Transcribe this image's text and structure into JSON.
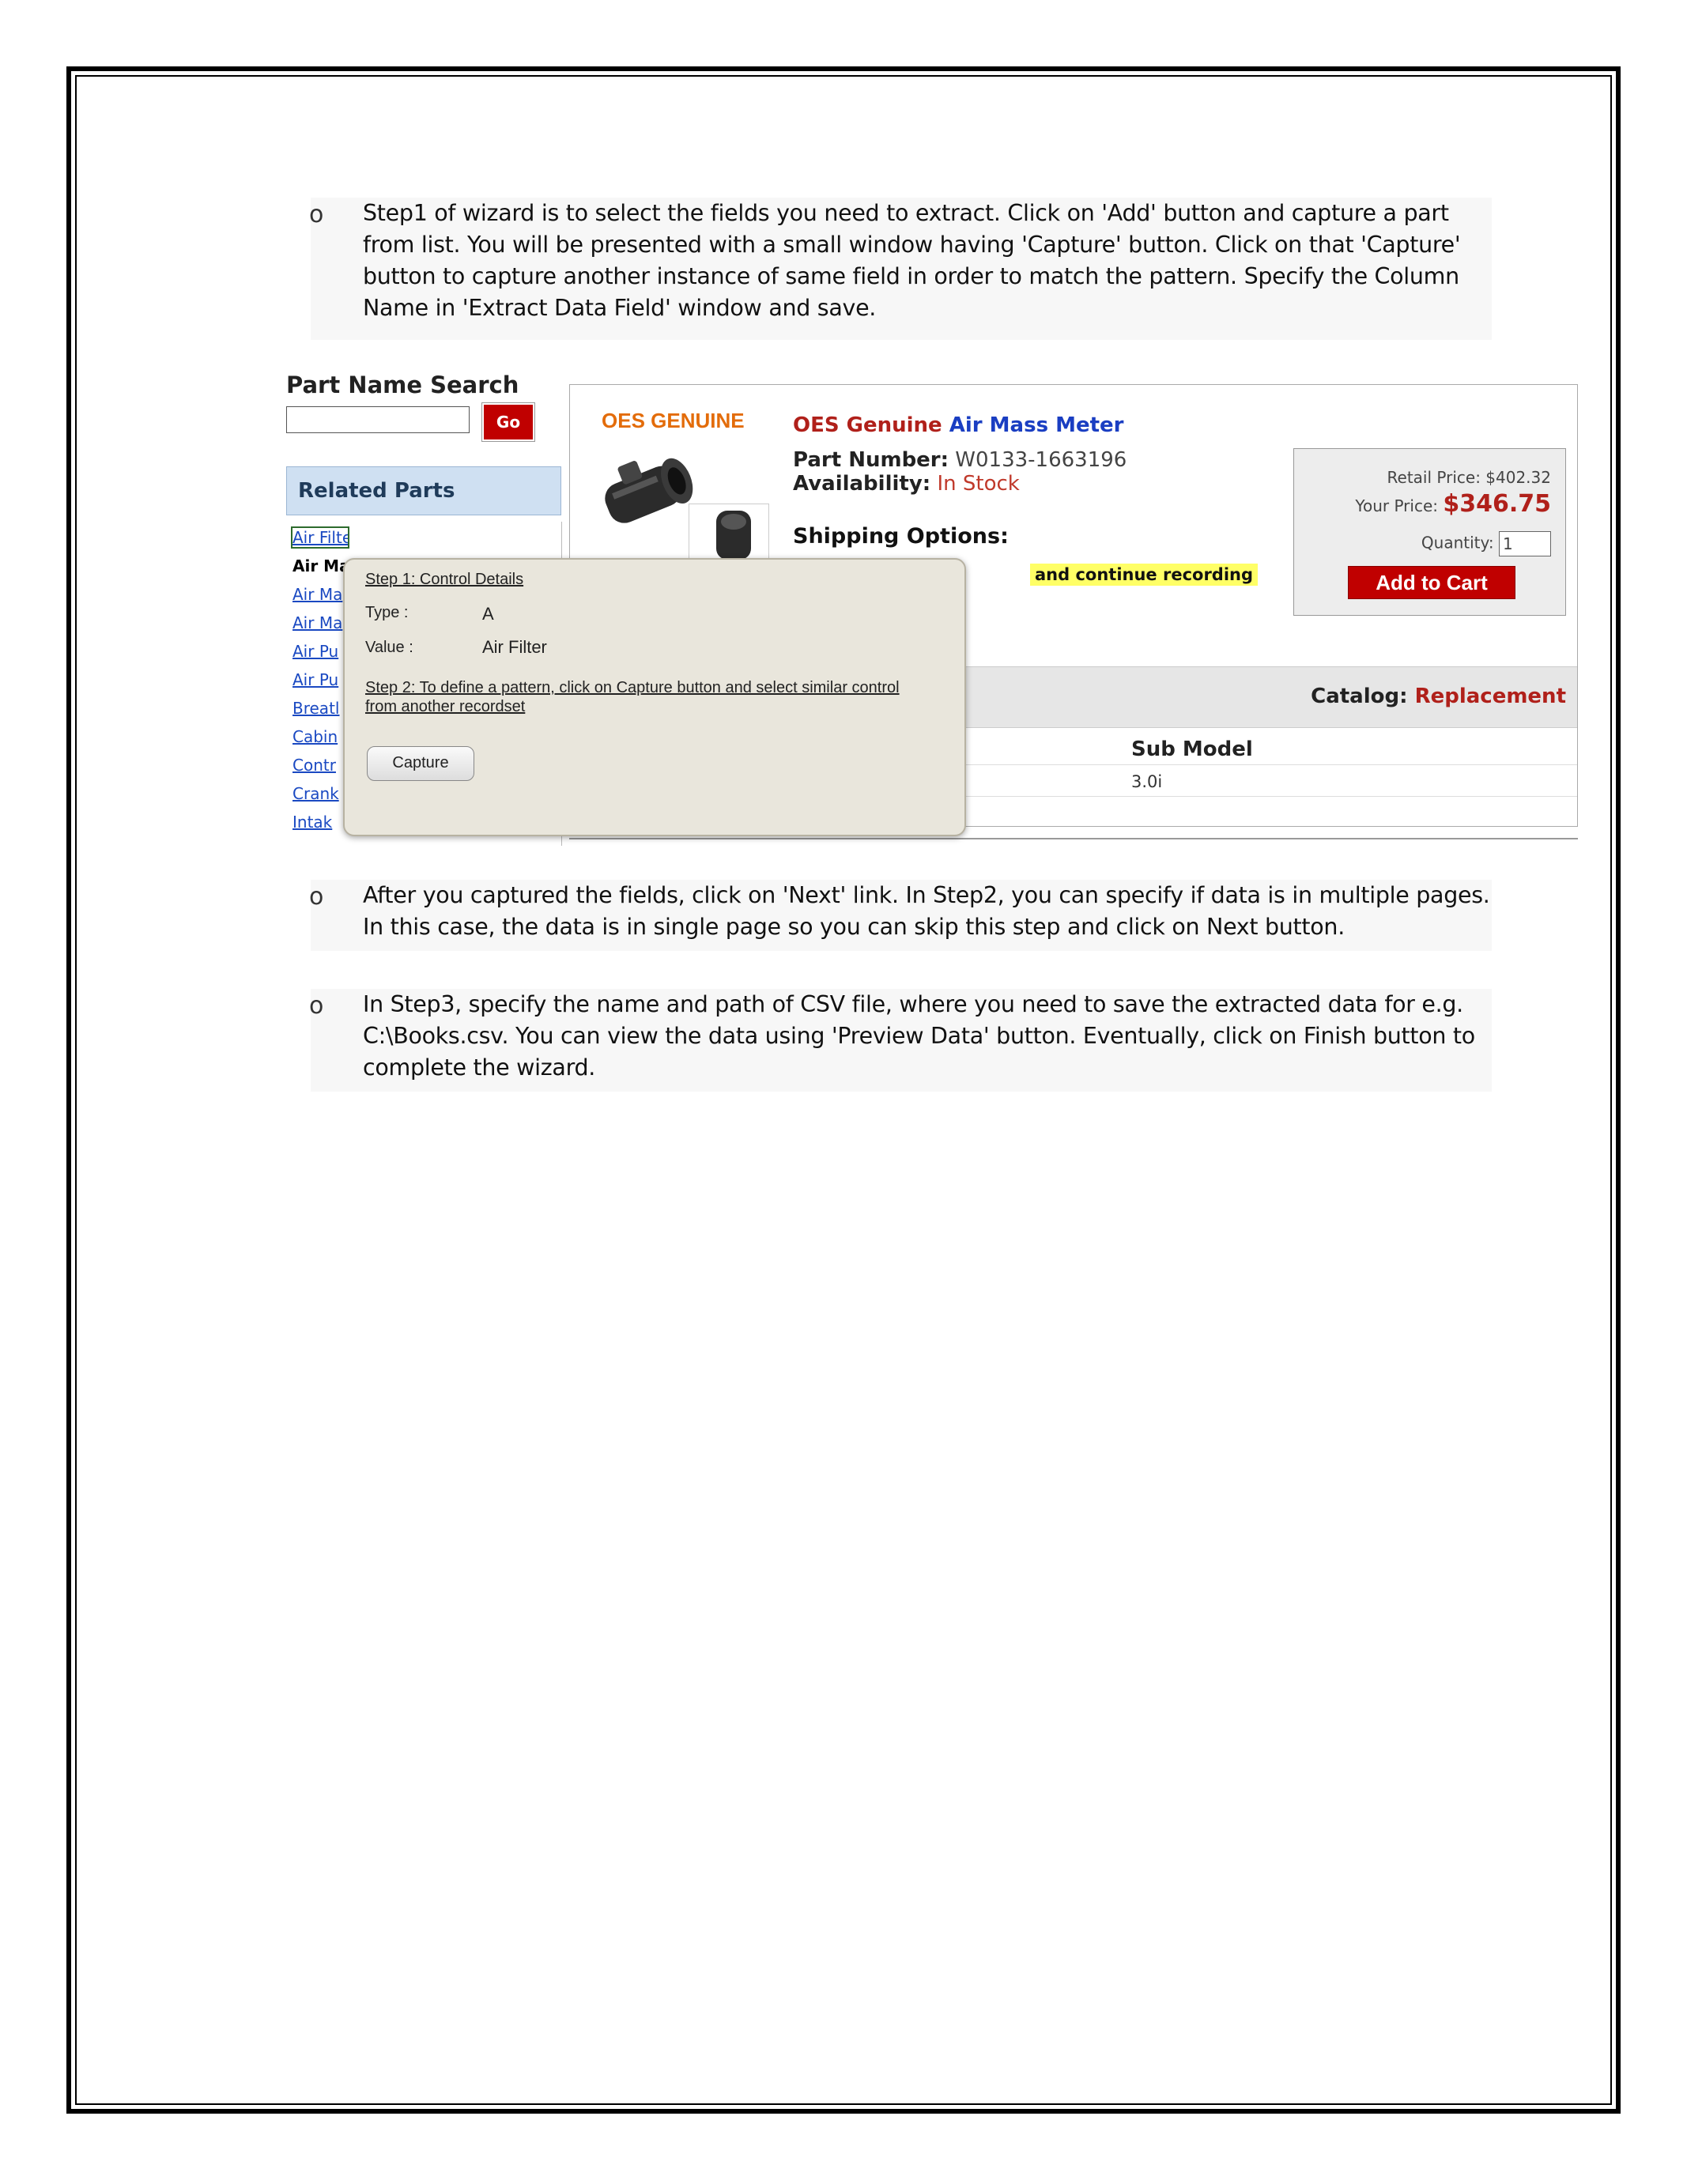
{
  "bullets": {
    "mark": "o",
    "step1": "Step1 of wizard is to select the fields you need to extract. Click on 'Add' button and capture a part from list. You will be presented with a small window having 'Capture' button. Click on that 'Capture' button to capture another instance of same field in order to match the pattern. Specify the Column Name in 'Extract Data Field' window and save.",
    "step2": "After you captured the fields, click on 'Next' link. In Step2, you can specify if data is in multiple pages. In this case, the data is in single page so you can skip this step and click on Next button.",
    "step3": "In Step3, specify the name and path of CSV file, where you need to save the extracted data for e.g. C:\\Books.csv. You can view the data using 'Preview Data' button. Eventually, click on Finish button to complete the wizard."
  },
  "screenshot": {
    "search": {
      "title": "Part Name Search",
      "go_label": "Go",
      "value": ""
    },
    "related": {
      "header": "Related Parts",
      "items": [
        "Air Filter",
        "Air Ma",
        "Air Ma",
        "Air Ma",
        "Air Pu",
        "Air Pu",
        "Breatl",
        "Cabin",
        "Contr",
        "Crank",
        "Intak"
      ]
    },
    "product": {
      "brand": "OES GENUINE",
      "name_part1": "OES Genuine",
      "name_part2": "Air Mass Meter",
      "part_number_label": "Part Number:",
      "part_number": "W0133-1663196",
      "availability_label": "Availability:",
      "availability": "In Stock",
      "shipping_label": "Shipping Options:",
      "highlight_text": "and continue recording",
      "retail_price": "Retail Price: $402.32",
      "your_price_label": "Your Price:",
      "your_price": "$346.75",
      "quantity_label": "Quantity:",
      "quantity": "1",
      "add_to_cart": "Add to Cart",
      "catalog_colon": ":",
      "catalog_label": "Catalog:",
      "catalog_value": "Replacement",
      "sub_model_header": "Sub Model",
      "sub_model_value": "3.0i"
    },
    "popup": {
      "step1": "Step 1: Control Details",
      "type_label": "Type :",
      "type_value": "A",
      "value_label": "Value :",
      "value_value": "Air Filter",
      "step2": "Step 2: To define a pattern, click on Capture button and select similar control from another recordset",
      "capture_label": "Capture"
    }
  },
  "colors": {
    "accent_red": "#c00000",
    "brand_orange": "#e36c0a",
    "link_blue": "#1a49c2",
    "highlight": "#ffff66"
  }
}
